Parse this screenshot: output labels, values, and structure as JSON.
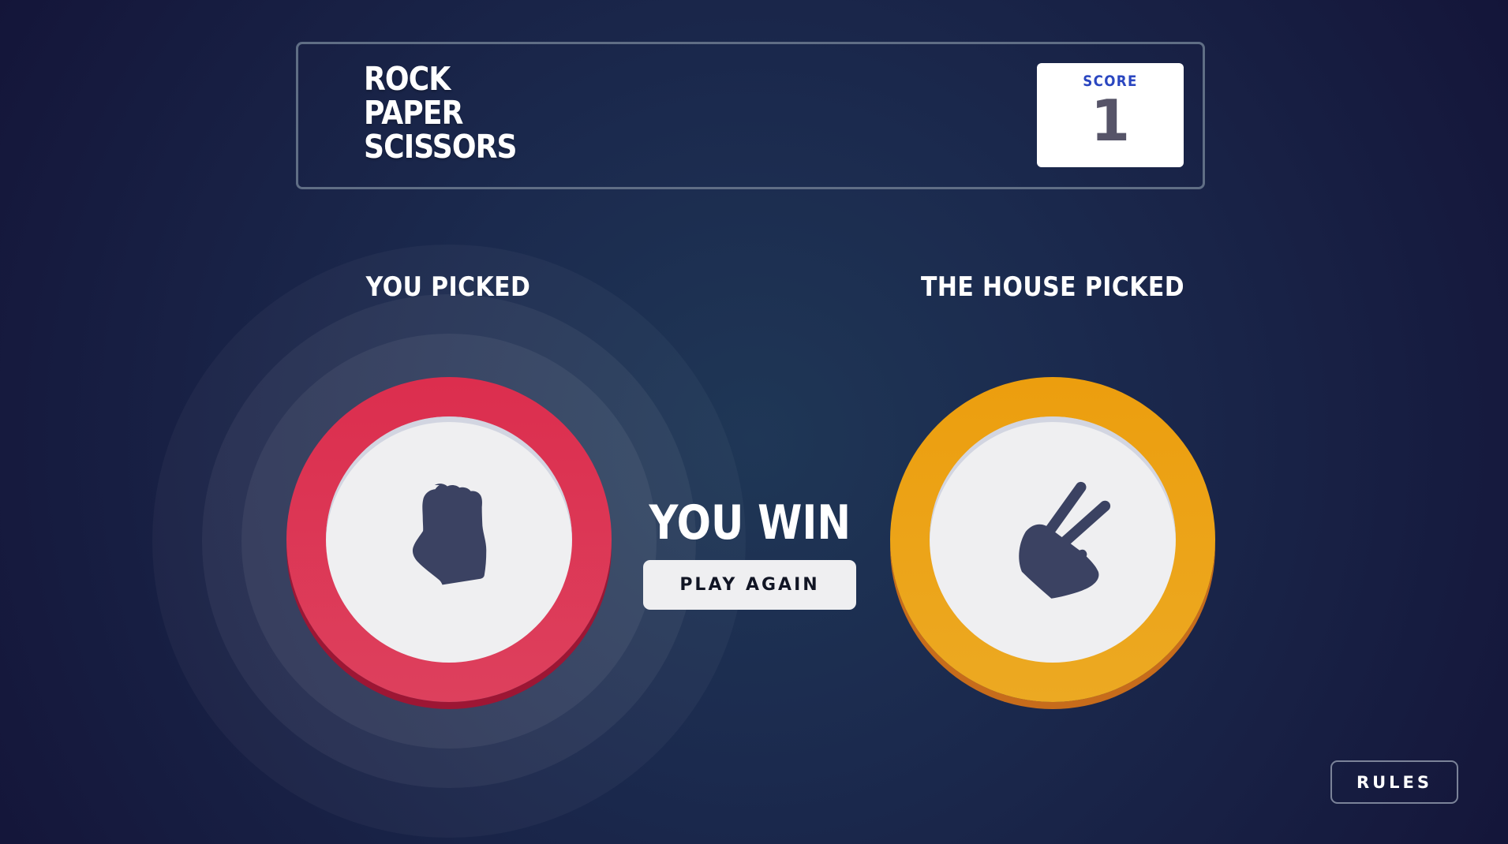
{
  "header": {
    "title_lines": [
      "ROCK",
      "PAPER",
      "SCISSORS"
    ],
    "score_label": "SCORE",
    "score_value": "1"
  },
  "player": {
    "label": "YOU PICKED",
    "choice": "rock",
    "icon": "rock-icon",
    "ring_color": "#dc2e4e",
    "winner": true
  },
  "house": {
    "label": "THE HOUSE PICKED",
    "choice": "scissors",
    "icon": "scissors-icon",
    "ring_color": "#ec9e0e"
  },
  "result": {
    "text": "YOU WIN",
    "play_again_label": "PLAY AGAIN"
  },
  "rules_label": "RULES",
  "colors": {
    "icon": "#3b4262",
    "score_label": "#2a46c0",
    "score_value": "#565468"
  }
}
